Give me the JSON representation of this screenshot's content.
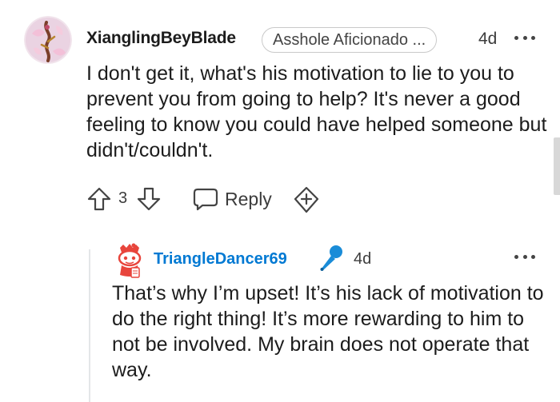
{
  "comment": {
    "username": "XianglingBeyBlade",
    "flair": "Asshole Aficionado ...",
    "age": "4d",
    "body": "I don't get it, what's his motivation to lie to you to prevent you from going to help? It's never a good feeling to know you could have helped someone but didn't/couldn't.",
    "votes": "3",
    "reply_label": "Reply",
    "icons": {
      "avatar": "avatar-icon",
      "more": "more-options-icon",
      "upvote": "upvote-arrow-icon",
      "downvote": "downvote-arrow-icon",
      "reply": "chat-bubble-icon",
      "award": "award-plus-icon"
    }
  },
  "reply": {
    "username": "TriangleDancer69",
    "age": "4d",
    "body": "That’s why I’m upset! It’s his lack of motivation to do the right thing! It’s more rewarding to him to not be involved. My brain does not operate that way.",
    "icons": {
      "avatar": "snoo-avatar-icon",
      "badge": "microphone-icon",
      "more": "more-options-icon"
    }
  },
  "colors": {
    "text": "#1c1c1c",
    "muted": "#3c3c3c",
    "reply_username": "#0079d3",
    "badge": "#1a8cd8",
    "thread_line": "#e4e6e8"
  }
}
